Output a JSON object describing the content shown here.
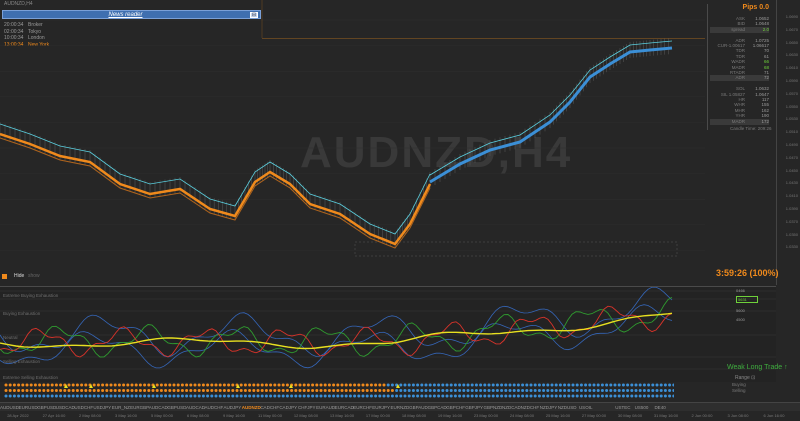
{
  "window": {
    "title": "AUDNZD,H4"
  },
  "news": {
    "title": "News reader",
    "close_icon": "close-icon"
  },
  "sessions": [
    {
      "time": "20:00:34",
      "name": "Broker",
      "active": false
    },
    {
      "time": "02:00:34",
      "name": "Tokyo",
      "active": false
    },
    {
      "time": "10:00:34",
      "name": "London",
      "active": false
    },
    {
      "time": "13:00:34",
      "name": "New York",
      "active": true
    }
  ],
  "watermark": "AUDNZD,H4",
  "info_panel": {
    "pips": "Pips 0.0",
    "rows": [
      {
        "k": "ASK",
        "v": "1.0652"
      },
      {
        "k": "BID",
        "v": "1.0648"
      },
      {
        "k": "spread",
        "v": "2.0",
        "green": true,
        "hl": true
      },
      {
        "k": "",
        "v": ""
      },
      {
        "k": "ADR",
        "v": "1.0725"
      },
      {
        "k": "CUR-1.00617",
        "v": "1.06617"
      },
      {
        "k": "TDR",
        "v": "70"
      },
      {
        "k": "TDR",
        "v": "61"
      },
      {
        "k": "WADR",
        "v": "66",
        "green": true
      },
      {
        "k": "MADR",
        "v": "68",
        "green": true
      },
      {
        "k": "RTADR",
        "v": "71"
      },
      {
        "k": "ADR",
        "v": "72",
        "hl": true
      },
      {
        "k": "",
        "v": ""
      },
      {
        "k": "SOL",
        "v": "1.0632"
      },
      {
        "k": "SIL 1.05827",
        "v": "1.0647"
      },
      {
        "k": "HR",
        "v": "117"
      },
      {
        "k": "WHR",
        "v": "155"
      },
      {
        "k": "MHR",
        "v": "162"
      },
      {
        "k": "YHR",
        "v": "190"
      },
      {
        "k": "MADR",
        "v": "172",
        "hl": true
      }
    ],
    "candle_time": "Candle Time: 209:26"
  },
  "price_ticks": [
    "1.0690",
    "1.0670",
    "1.0650",
    "1.0630",
    "1.0610",
    "1.0590",
    "1.0570",
    "1.0550",
    "1.0530",
    "1.0510",
    "1.0490",
    "1.0470",
    "1.0450",
    "1.0430",
    "1.0410",
    "1.0390",
    "1.0370",
    "1.0350",
    "1.0330"
  ],
  "hide": {
    "label": "Hide",
    "sub": "show"
  },
  "timer": "3:59:26 (100%)",
  "subwindow": {
    "labels": [
      "Extreme Buying Exhaustion",
      "Buying Exhaustion",
      "Neutral",
      "Selling Exhaustion",
      "Extreme Selling Exhaustion"
    ],
    "levels": [
      {
        "text": "0466",
        "green": false
      },
      {
        "text": "5631",
        "green": true
      },
      {
        "text": "5600",
        "green": false
      },
      {
        "text": "4500",
        "green": false
      }
    ],
    "weak_trade": "Weak Long Trade ↑",
    "range": "Range ⊡"
  },
  "dots_legend": [
    "Buying",
    "Selling"
  ],
  "symbols": [
    "AUDUSD",
    "EURUSD",
    "GBPUSD",
    "USDCAD",
    "USDCHF",
    "USDJPY",
    "EUR_NZ",
    "EURGBP",
    "AUDCAD",
    "GBPUSD",
    "AUDCAD",
    "AUDCHF",
    "AUDJPY",
    "AUDNZD",
    "CADCHF",
    "CADJPY",
    "CHFJPY",
    "EURAUD",
    "EURCAD",
    "EURCHF",
    "EURJPY",
    "EURNZD",
    "GBPAUD",
    "GBPCAD",
    "GBPCHF",
    "GBPJPY",
    "GBPNZD",
    "NZDCAD",
    "NZDCHF",
    "NZDJPY",
    "NZDUSD",
    "USOIL",
    "",
    "USTEC",
    "US500",
    "DE40"
  ],
  "active_symbol": "AUDNZD",
  "time_ticks": [
    "28 Apr 2022",
    "27 Apr 16:00",
    "2 May 08:00",
    "3 May 16:00",
    "5 May 00:00",
    "6 May 08:00",
    "9 May 16:00",
    "11 May 00:00",
    "12 May 08:00",
    "13 May 16:00",
    "17 May 00:00",
    "18 May 08:00",
    "19 May 16:00",
    "23 May 00:00",
    "24 May 08:00",
    "25 May 16:00",
    "27 May 00:00",
    "30 May 08:00",
    "31 May 16:00",
    "2 Jun 00:00",
    "3 Jun 08:00",
    "6 Jun 16:00"
  ]
}
